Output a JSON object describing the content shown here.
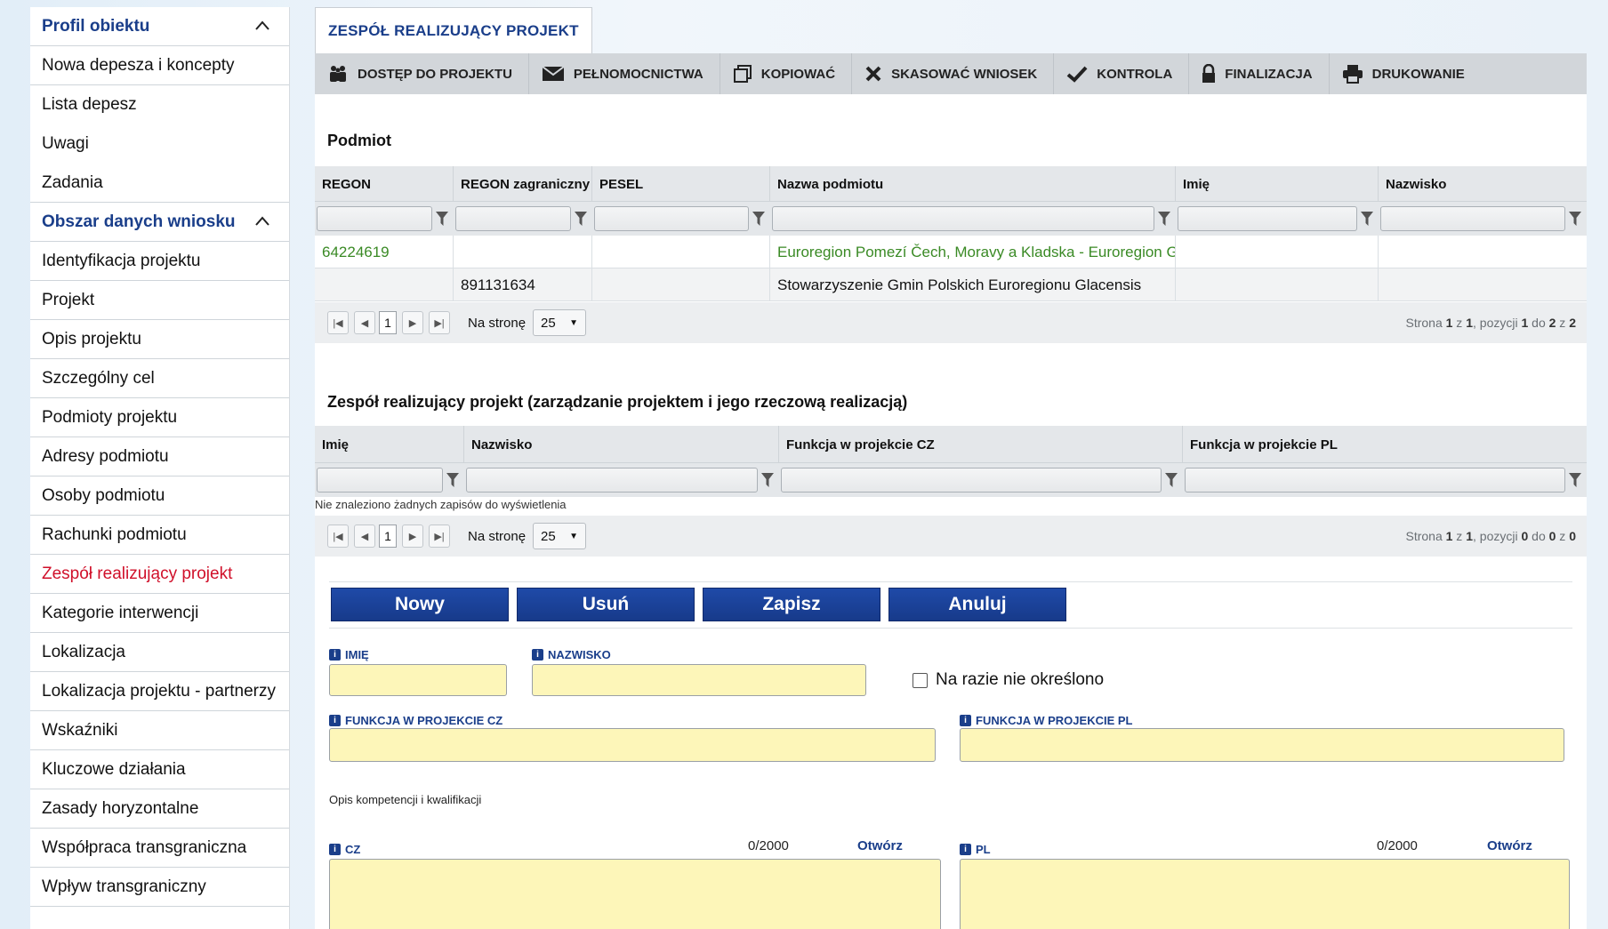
{
  "sidebar": {
    "items": [
      {
        "label": "Profil obiektu"
      },
      {
        "label": "Nowa depesza i koncepty"
      },
      {
        "label": "Lista depesz"
      },
      {
        "label": "Uwagi"
      },
      {
        "label": "Zadania"
      },
      {
        "label": "Obszar danych wniosku"
      },
      {
        "label": "Identyfikacja projektu"
      },
      {
        "label": "Projekt"
      },
      {
        "label": "Opis projektu"
      },
      {
        "label": "Szczególny cel"
      },
      {
        "label": "Podmioty projektu"
      },
      {
        "label": "Adresy podmiotu"
      },
      {
        "label": "Osoby podmiotu"
      },
      {
        "label": "Rachunki podmiotu"
      },
      {
        "label": "Zespół realizujący projekt"
      },
      {
        "label": "Kategorie interwencji"
      },
      {
        "label": "Lokalizacja"
      },
      {
        "label": "Lokalizacja projektu - partnerzy"
      },
      {
        "label": "Wskaźniki"
      },
      {
        "label": "Kluczowe działania"
      },
      {
        "label": "Zasady horyzontalne"
      },
      {
        "label": "Współpraca transgraniczna"
      },
      {
        "label": "Wpływ transgraniczny"
      }
    ]
  },
  "tab": {
    "label": "ZESPÓŁ REALIZUJĄCY PROJEKT"
  },
  "toolbar": {
    "access": "DOSTĘP DO PROJEKTU",
    "powers": "PEŁNOMOCNICTWA",
    "copy": "KOPIOWAĆ",
    "delete": "SKASOWAĆ WNIOSEK",
    "check": "KONTROLA",
    "finalize": "FINALIZACJA",
    "print": "DRUKOWANIE"
  },
  "subject": {
    "title": "Podmiot",
    "columns": [
      "REGON",
      "REGON zagraniczny",
      "PESEL",
      "Nazwa podmiotu",
      "Imię",
      "Nazwisko"
    ],
    "rows": [
      [
        "64224619",
        "",
        "",
        "Euroregion Pomezí Čech, Moravy a Kladska - Euroregion G...",
        "",
        ""
      ],
      [
        "",
        "891131634",
        "",
        "Stowarzyszenie Gmin Polskich Euroregionu Glacensis",
        "",
        ""
      ]
    ],
    "pager": {
      "page": "1",
      "per_page_label": "Na stronę",
      "per_page": "25",
      "info_prefix": "Strona ",
      "info_page": "1",
      "info_of": " z ",
      "info_pages": "1",
      "info_pos": ", pozycji ",
      "info_from": "1",
      "info_to_label": " do ",
      "info_to": "2",
      "info_z": " z ",
      "info_total": "2"
    }
  },
  "team": {
    "title": "Zespół realizujący projekt (zarządzanie projektem i jego rzeczową realizacją)",
    "columns": [
      "Imię",
      "Nazwisko",
      "Funkcja w projekcie CZ",
      "Funkcja w projekcie PL"
    ],
    "empty": "Nie znaleziono żadnych zapisów do wyświetlenia",
    "pager": {
      "page": "1",
      "per_page_label": "Na stronę",
      "per_page": "25",
      "info_prefix": "Strona ",
      "info_page": "1",
      "info_of": " z ",
      "info_pages": "1",
      "info_pos": ", pozycji ",
      "info_from": "0",
      "info_to_label": " do ",
      "info_to": "0",
      "info_z": " z ",
      "info_total": "0"
    }
  },
  "actions": {
    "new": "Nowy",
    "delete": "Usuń",
    "save": "Zapisz",
    "cancel": "Anuluj"
  },
  "form": {
    "first_name": "IMIĘ",
    "last_name": "NAZWISKO",
    "not_specified": "Na razie nie określono",
    "function_cz": "FUNKCJA W PROJEKCIE CZ",
    "function_pl": "FUNKCJA W PROJEKCIE PL",
    "competence": "Opis kompetencji i kwalifikacji",
    "cz_label": "CZ",
    "cz_count": "0/2000",
    "cz_open": "Otwórz",
    "pl_label": "PL",
    "pl_count": "0/2000",
    "pl_open": "Otwórz",
    "info_badge": "i"
  },
  "colors": {
    "accent": "#1a3e8a",
    "active_nav": "#d0102a",
    "link": "#3a8a25",
    "field": "#fdf6b9",
    "button": "#1f4aa8"
  }
}
